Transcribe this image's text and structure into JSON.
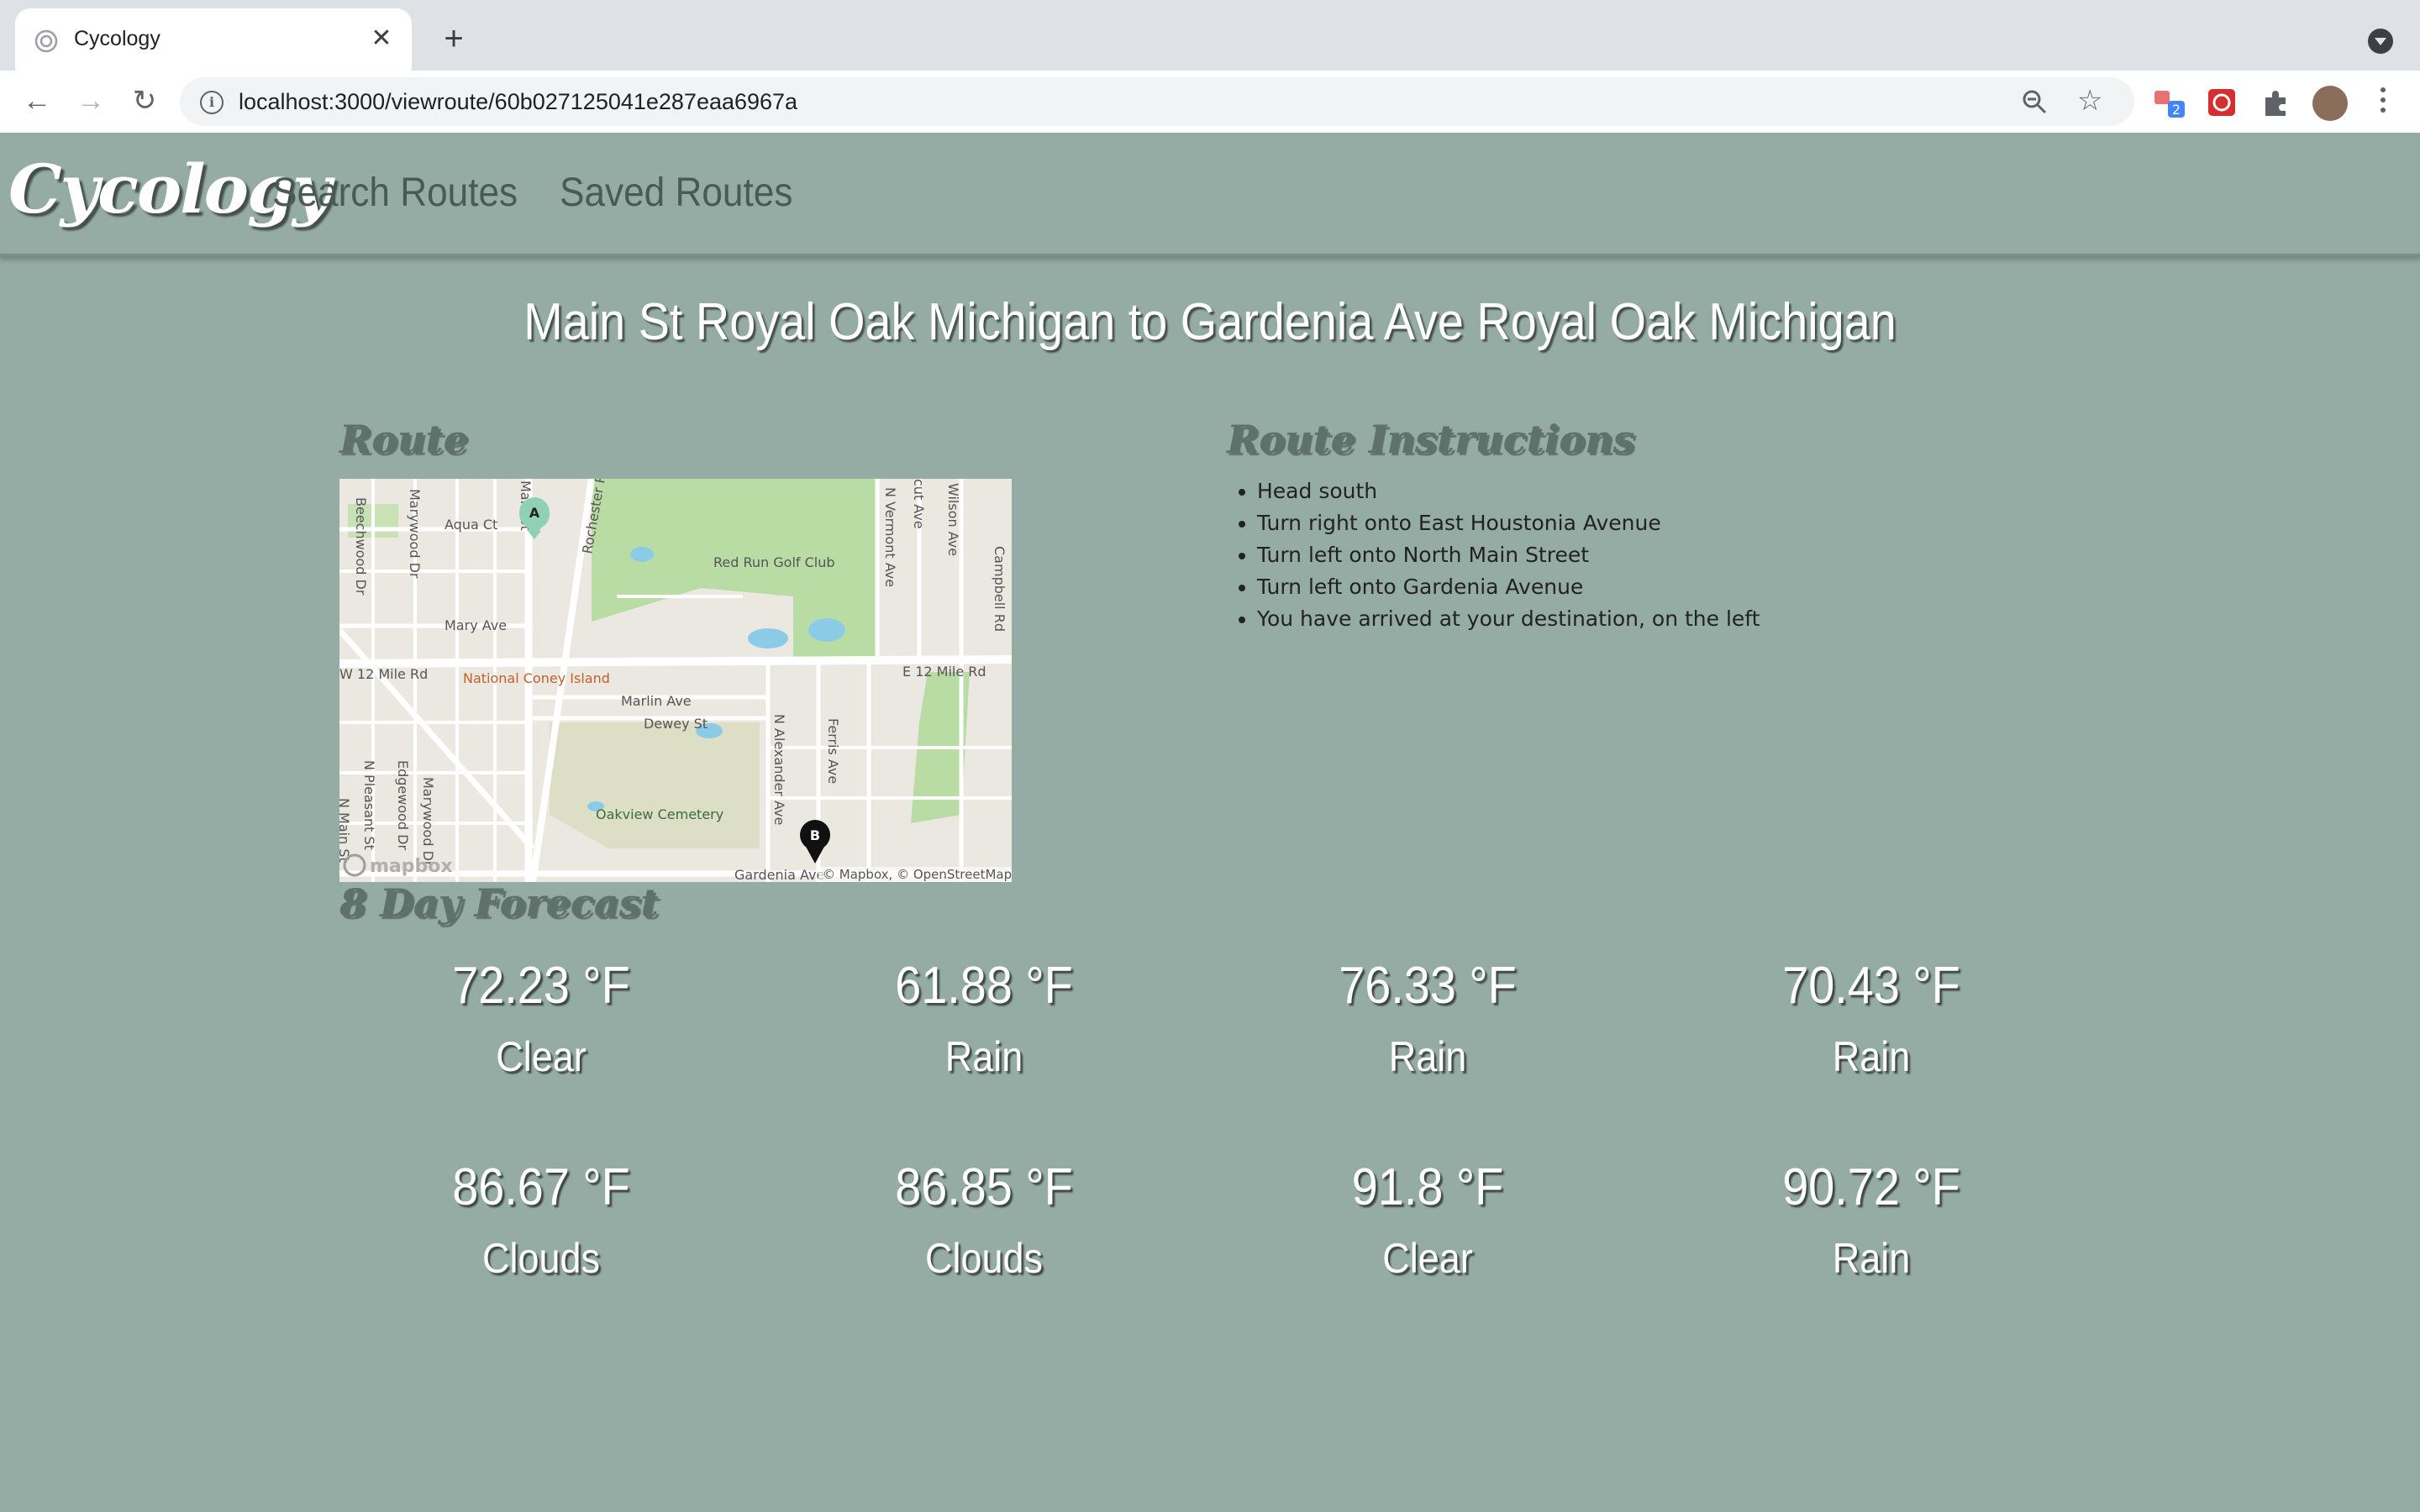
{
  "browser": {
    "tab_title": "Cycology",
    "url": "localhost:3000/viewroute/60b027125041e287eaa6967a",
    "extension_badge": "2"
  },
  "nav": {
    "brand": "Cycology",
    "links": [
      "Search Routes",
      "Saved Routes"
    ]
  },
  "route": {
    "title": "Main St Royal Oak Michigan to Gardenia Ave Royal Oak Michigan",
    "route_heading": "Route",
    "instructions_heading": "Route Instructions",
    "instructions": [
      "Head south",
      "Turn right onto East Houstonia Avenue",
      "Turn left onto North Main Street",
      "Turn left onto Gardenia Avenue",
      "You have arrived at your destination, on the left"
    ]
  },
  "map": {
    "marker_a": "A",
    "marker_b": "B",
    "labels": {
      "aqua_ct": "Aqua Ct",
      "mary_ave": "Mary Ave",
      "red_run": "Red Run Golf Club",
      "w12": "W 12 Mile Rd",
      "e12": "E 12 Mile Rd",
      "coney": "National Coney Island",
      "marlin": "Marlin Ave",
      "dewey": "Dewey St",
      "oakview": "Oakview Cemetery",
      "gardenia": "Gardenia Ave",
      "attribution": "© Mapbox, © OpenStreetMap",
      "logo": "mapbox",
      "beechwood": "Beechwood Dr",
      "marywood": "Marywood Dr",
      "main": "Main St",
      "rochester": "Rochester Rd",
      "vermont": "N Vermont Ave",
      "cut": "cut Ave",
      "wilson": "Wilson Ave",
      "campbell": "Campbell Rd",
      "alexander": "N Alexander Ave",
      "ferris": "Ferris Ave",
      "pleasant": "N Pleasant St",
      "edgewood": "Edgewood Dr",
      "marywood2": "Marywood Dr",
      "nmain": "N Main St"
    }
  },
  "forecast": {
    "heading": "8 Day Forecast",
    "days": [
      {
        "temp": "72.23 °F",
        "cond": "Clear"
      },
      {
        "temp": "61.88 °F",
        "cond": "Rain"
      },
      {
        "temp": "76.33 °F",
        "cond": "Rain"
      },
      {
        "temp": "70.43 °F",
        "cond": "Rain"
      },
      {
        "temp": "86.67 °F",
        "cond": "Clouds"
      },
      {
        "temp": "86.85 °F",
        "cond": "Clouds"
      },
      {
        "temp": "91.8 °F",
        "cond": "Clear"
      },
      {
        "temp": "90.72 °F",
        "cond": "Rain"
      }
    ]
  }
}
